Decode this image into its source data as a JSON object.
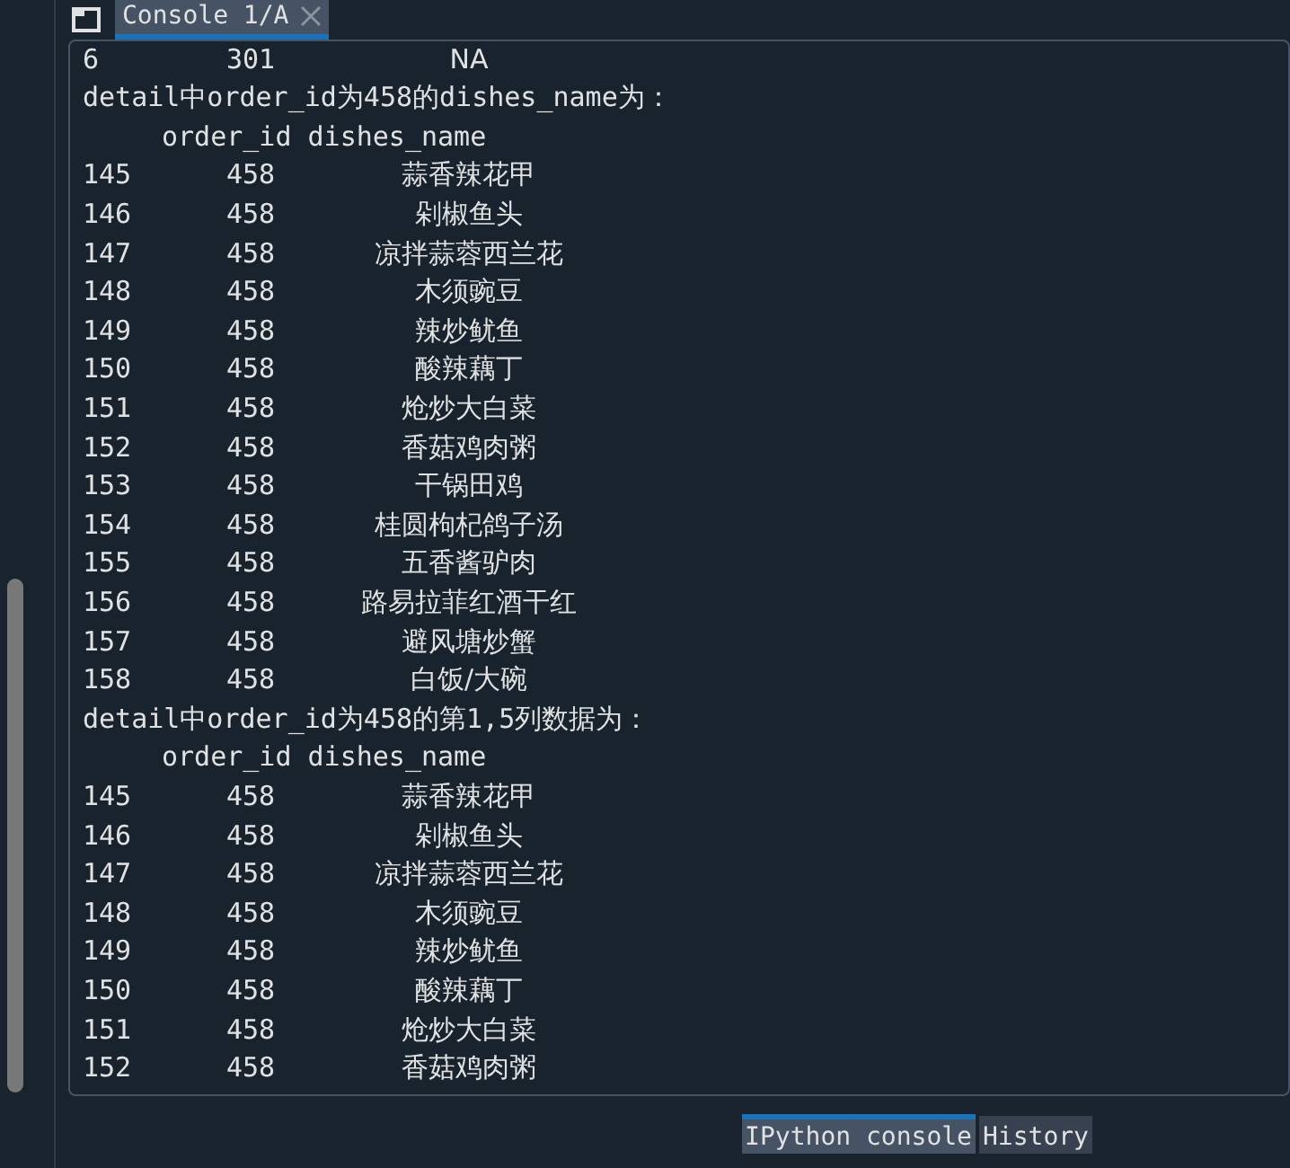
{
  "console_tab": {
    "label": "Console 1/A",
    "selected": true
  },
  "lines": [
    {
      "kind": "row",
      "index": "6",
      "order_id": "301",
      "dishes_name": "NA"
    },
    {
      "kind": "text",
      "text": "detail中order_id为458的dishes_name为："
    },
    {
      "kind": "header",
      "text": "order_id dishes_name"
    },
    {
      "kind": "row",
      "index": "145",
      "order_id": "458",
      "dishes_name": "蒜香辣花甲"
    },
    {
      "kind": "row",
      "index": "146",
      "order_id": "458",
      "dishes_name": "剁椒鱼头"
    },
    {
      "kind": "row",
      "index": "147",
      "order_id": "458",
      "dishes_name": "凉拌蒜蓉西兰花"
    },
    {
      "kind": "row",
      "index": "148",
      "order_id": "458",
      "dishes_name": "木须豌豆"
    },
    {
      "kind": "row",
      "index": "149",
      "order_id": "458",
      "dishes_name": "辣炒鱿鱼"
    },
    {
      "kind": "row",
      "index": "150",
      "order_id": "458",
      "dishes_name": "酸辣藕丁"
    },
    {
      "kind": "row",
      "index": "151",
      "order_id": "458",
      "dishes_name": "炝炒大白菜"
    },
    {
      "kind": "row",
      "index": "152",
      "order_id": "458",
      "dishes_name": "香菇鸡肉粥"
    },
    {
      "kind": "row",
      "index": "153",
      "order_id": "458",
      "dishes_name": "干锅田鸡"
    },
    {
      "kind": "row",
      "index": "154",
      "order_id": "458",
      "dishes_name": "桂圆枸杞鸽子汤"
    },
    {
      "kind": "row",
      "index": "155",
      "order_id": "458",
      "dishes_name": "五香酱驴肉"
    },
    {
      "kind": "row",
      "index": "156",
      "order_id": "458",
      "dishes_name": "路易拉菲红酒干红"
    },
    {
      "kind": "row",
      "index": "157",
      "order_id": "458",
      "dishes_name": "避风塘炒蟹"
    },
    {
      "kind": "row",
      "index": "158",
      "order_id": "458",
      "dishes_name": "白饭/大碗"
    },
    {
      "kind": "text",
      "text": "detail中order_id为458的第1,5列数据为："
    },
    {
      "kind": "header",
      "text": "order_id dishes_name"
    },
    {
      "kind": "row",
      "index": "145",
      "order_id": "458",
      "dishes_name": "蒜香辣花甲"
    },
    {
      "kind": "row",
      "index": "146",
      "order_id": "458",
      "dishes_name": "剁椒鱼头"
    },
    {
      "kind": "row",
      "index": "147",
      "order_id": "458",
      "dishes_name": "凉拌蒜蓉西兰花"
    },
    {
      "kind": "row",
      "index": "148",
      "order_id": "458",
      "dishes_name": "木须豌豆"
    },
    {
      "kind": "row",
      "index": "149",
      "order_id": "458",
      "dishes_name": "辣炒鱿鱼"
    },
    {
      "kind": "row",
      "index": "150",
      "order_id": "458",
      "dishes_name": "酸辣藕丁"
    },
    {
      "kind": "row",
      "index": "151",
      "order_id": "458",
      "dishes_name": "炝炒大白菜"
    },
    {
      "kind": "row",
      "index": "152",
      "order_id": "458",
      "dishes_name": "香菇鸡肉粥"
    }
  ],
  "bottom_tabs": [
    {
      "label": "IPython console",
      "selected": true
    },
    {
      "label": "History",
      "selected": false
    }
  ]
}
